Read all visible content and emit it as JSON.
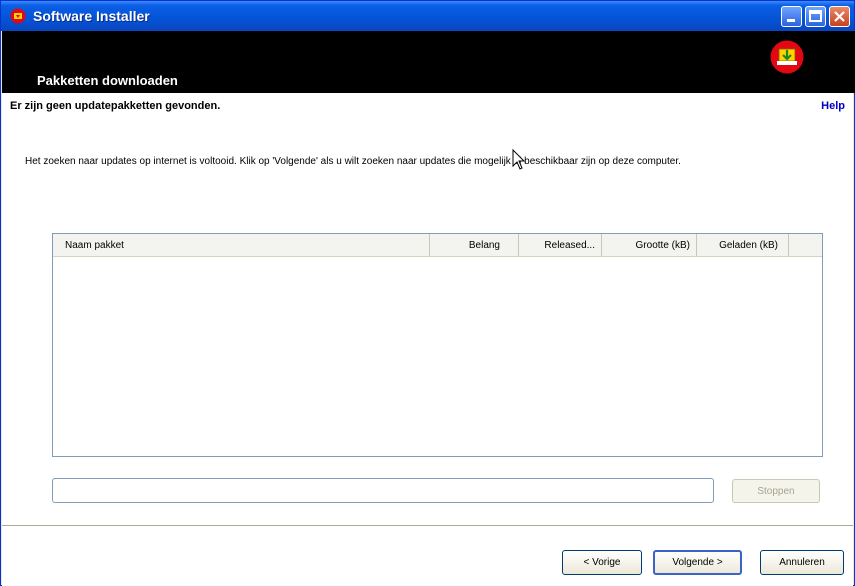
{
  "window": {
    "title": "Software Installer"
  },
  "header": {
    "title": "Pakketten downloaden"
  },
  "content": {
    "subtitle": "Er zijn geen updatepakketten gevonden.",
    "help_label": "Help",
    "description": "Het zoeken naar updates op internet is voltooid. Klik op 'Volgende' als u wilt zoeken naar updates die mogelijk al beschikbaar zijn op deze computer."
  },
  "table": {
    "columns": [
      "Naam pakket",
      "Belang",
      "Released...",
      "Grootte (kB)",
      "Geladen (kB)"
    ],
    "rows": []
  },
  "progress": {
    "value": 0
  },
  "buttons": {
    "stop": "Stoppen",
    "back": "< Vorige",
    "next": "Volgende >",
    "cancel": "Annuleren"
  },
  "colors": {
    "titlebar": "#0453d6",
    "header_bg": "#000000",
    "help_link": "#0000cc",
    "icon_red": "#e30613"
  }
}
